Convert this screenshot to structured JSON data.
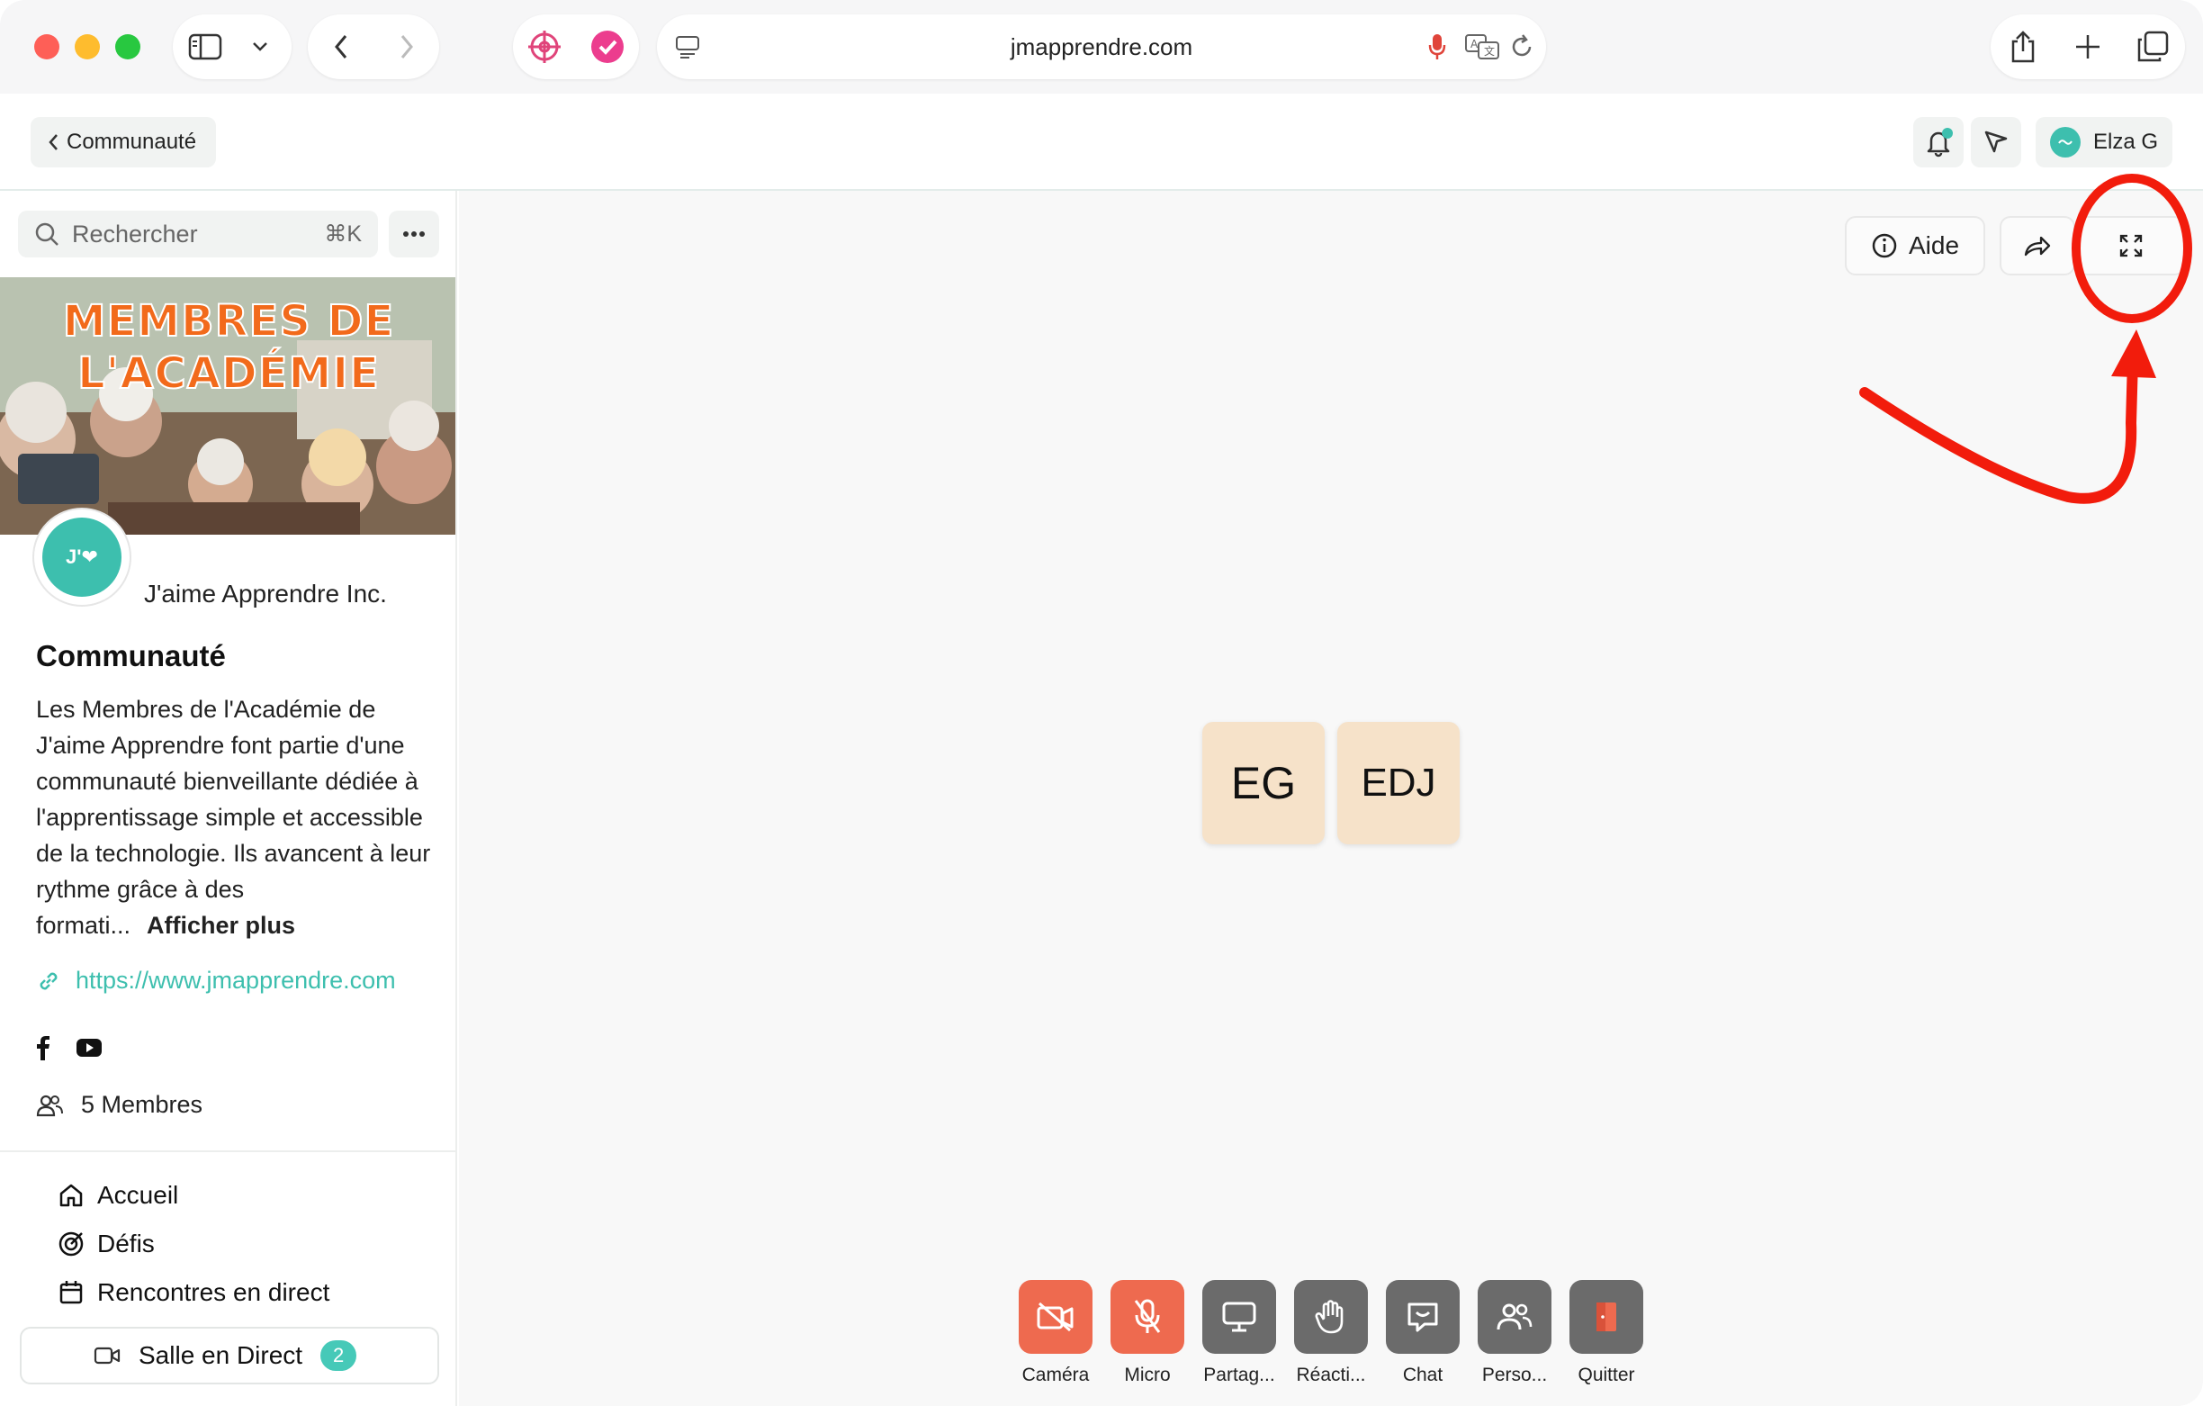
{
  "browser": {
    "url": "jmapprendre.com"
  },
  "header": {
    "back_label": "Communauté",
    "user_name": "Elza G"
  },
  "sidebar": {
    "search_placeholder": "Rechercher",
    "search_shortcut": "⌘K",
    "banner_title_line1": "MEMBRES DE",
    "banner_title_line2": "L'ACADÉMIE",
    "avatar_text": "J'❤",
    "org_name": "J'aime Apprendre Inc.",
    "community_title": "Communauté",
    "description": "Les Membres de l'Académie de J'aime Apprendre font partie d'une communauté bienveillante dédiée à l'apprentissage simple et accessible de la technologie. Ils avancent à leur rythme grâce à des formati...",
    "show_more": "Afficher plus",
    "link": "https://www.jmapprendre.com",
    "members": "5 Membres",
    "nav": [
      {
        "label": "Accueil",
        "icon": "home-icon"
      },
      {
        "label": "Défis",
        "icon": "target-icon"
      },
      {
        "label": "Rencontres en direct",
        "icon": "calendar-icon"
      }
    ],
    "live_room": {
      "label": "Salle en Direct",
      "count": "2"
    }
  },
  "main": {
    "help_label": "Aide",
    "participants": [
      "EG",
      "EDJ"
    ],
    "controls": [
      {
        "label": "Caméra",
        "icon": "camera-off-icon",
        "color": "#ee6a4f"
      },
      {
        "label": "Micro",
        "icon": "mic-off-icon",
        "color": "#ee6a4f"
      },
      {
        "label": "Partag...",
        "icon": "screen-share-icon",
        "color": "#6b6b6b"
      },
      {
        "label": "Réacti...",
        "icon": "hand-icon",
        "color": "#6b6b6b"
      },
      {
        "label": "Chat",
        "icon": "chat-icon",
        "color": "#6b6b6b"
      },
      {
        "label": "Perso...",
        "icon": "people-icon",
        "color": "#6b6b6b"
      },
      {
        "label": "Quitter",
        "icon": "exit-icon",
        "color": "#6b6b6b"
      }
    ]
  },
  "colors": {
    "accent": "#3dbfae",
    "annotation": "#f21c0c",
    "tile": "#f6e2c9"
  }
}
